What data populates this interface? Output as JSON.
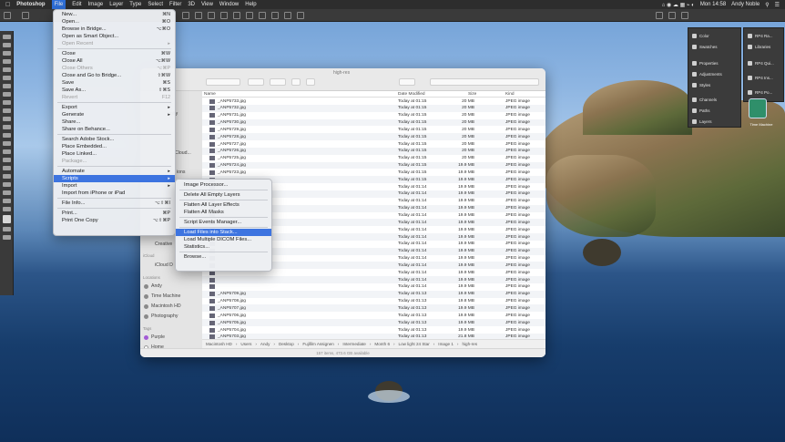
{
  "menubar": {
    "app": "Photoshop",
    "items": [
      "File",
      "Edit",
      "Image",
      "Layer",
      "Type",
      "Select",
      "Filter",
      "3D",
      "View",
      "Window",
      "Help"
    ],
    "clock": "Mon 14:58",
    "user": "Andy Noble"
  },
  "file_menu": [
    {
      "label": "New...",
      "sc": "⌘N"
    },
    {
      "label": "Open...",
      "sc": "⌘O"
    },
    {
      "label": "Browse in Bridge...",
      "sc": "⌥⌘O"
    },
    {
      "label": "Open as Smart Object..."
    },
    {
      "label": "Open Recent",
      "disabled": true,
      "sub": true
    },
    {
      "sep": true
    },
    {
      "label": "Close",
      "sc": "⌘W"
    },
    {
      "label": "Close All",
      "sc": "⌥⌘W"
    },
    {
      "label": "Close Others",
      "disabled": true,
      "sc": "⌥⌘P"
    },
    {
      "label": "Close and Go to Bridge...",
      "sc": "⇧⌘W"
    },
    {
      "label": "Save",
      "sc": "⌘S"
    },
    {
      "label": "Save As...",
      "sc": "⇧⌘S"
    },
    {
      "label": "Revert",
      "disabled": true,
      "sc": "F12"
    },
    {
      "sep": true
    },
    {
      "label": "Export",
      "sub": true
    },
    {
      "label": "Generate",
      "sub": true
    },
    {
      "label": "Share..."
    },
    {
      "label": "Share on Behance..."
    },
    {
      "sep": true
    },
    {
      "label": "Search Adobe Stock..."
    },
    {
      "label": "Place Embedded..."
    },
    {
      "label": "Place Linked..."
    },
    {
      "label": "Package...",
      "disabled": true
    },
    {
      "sep": true
    },
    {
      "label": "Automate",
      "sub": true
    },
    {
      "label": "Scripts",
      "sub": true,
      "highlight": true
    },
    {
      "label": "Import",
      "sub": true
    },
    {
      "label": "Import from iPhone or iPad"
    },
    {
      "sep": true
    },
    {
      "label": "File Info...",
      "sc": "⌥⇧⌘I"
    },
    {
      "sep": true
    },
    {
      "label": "Print...",
      "sc": "⌘P"
    },
    {
      "label": "Print One Copy",
      "sc": "⌥⇧⌘P"
    }
  ],
  "scripts_menu": [
    {
      "label": "Image Processor..."
    },
    {
      "sep": true
    },
    {
      "label": "Delete All Empty Layers"
    },
    {
      "sep": true
    },
    {
      "label": "Flatten All Layer Effects"
    },
    {
      "label": "Flatten All Masks"
    },
    {
      "sep": true
    },
    {
      "label": "Script Events Manager..."
    },
    {
      "sep": true
    },
    {
      "label": "Load Files into Stack...",
      "highlight": true
    },
    {
      "label": "Load Multiple DICOM Files..."
    },
    {
      "label": "Statistics..."
    },
    {
      "sep": true
    },
    {
      "label": "Browse..."
    }
  ],
  "finder": {
    "title": "high-res",
    "columns": {
      "name": "Name",
      "date": "Date Modified",
      "size": "Size",
      "kind": "Kind"
    },
    "files": [
      {
        "name": "_ANP5733.jpg",
        "date": "Today at 01:15",
        "size": "20 MB",
        "kind": "JPEG image"
      },
      {
        "name": "_ANP5732.jpg",
        "date": "Today at 01:15",
        "size": "20 MB",
        "kind": "JPEG image"
      },
      {
        "name": "_ANP5731.jpg",
        "date": "Today at 01:15",
        "size": "20 MB",
        "kind": "JPEG image"
      },
      {
        "name": "_ANP5730.jpg",
        "date": "Today at 01:15",
        "size": "20 MB",
        "kind": "JPEG image"
      },
      {
        "name": "_ANP5729.jpg",
        "date": "Today at 01:15",
        "size": "20 MB",
        "kind": "JPEG image"
      },
      {
        "name": "_ANP5728.jpg",
        "date": "Today at 01:15",
        "size": "20 MB",
        "kind": "JPEG image"
      },
      {
        "name": "_ANP5727.jpg",
        "date": "Today at 01:15",
        "size": "20 MB",
        "kind": "JPEG image"
      },
      {
        "name": "_ANP5726.jpg",
        "date": "Today at 01:15",
        "size": "20 MB",
        "kind": "JPEG image"
      },
      {
        "name": "_ANP5725.jpg",
        "date": "Today at 01:15",
        "size": "20 MB",
        "kind": "JPEG image"
      },
      {
        "name": "_ANP5724.jpg",
        "date": "Today at 01:15",
        "size": "19.9 MB",
        "kind": "JPEG image"
      },
      {
        "name": "_ANP5723.jpg",
        "date": "Today at 01:15",
        "size": "19.9 MB",
        "kind": "JPEG image"
      },
      {
        "name": "",
        "date": "Today at 01:15",
        "size": "19.9 MB",
        "kind": "JPEG image"
      },
      {
        "name": "",
        "date": "Today at 01:14",
        "size": "19.9 MB",
        "kind": "JPEG image"
      },
      {
        "name": "",
        "date": "Today at 01:14",
        "size": "19.9 MB",
        "kind": "JPEG image"
      },
      {
        "name": "",
        "date": "Today at 01:14",
        "size": "19.9 MB",
        "kind": "JPEG image"
      },
      {
        "name": "",
        "date": "Today at 01:14",
        "size": "19.9 MB",
        "kind": "JPEG image"
      },
      {
        "name": "",
        "date": "Today at 01:14",
        "size": "19.9 MB",
        "kind": "JPEG image"
      },
      {
        "name": "",
        "date": "Today at 01:14",
        "size": "19.9 MB",
        "kind": "JPEG image"
      },
      {
        "name": "",
        "date": "Today at 01:14",
        "size": "19.9 MB",
        "kind": "JPEG image"
      },
      {
        "name": "",
        "date": "Today at 01:14",
        "size": "19.9 MB",
        "kind": "JPEG image"
      },
      {
        "name": "",
        "date": "Today at 01:14",
        "size": "19.9 MB",
        "kind": "JPEG image"
      },
      {
        "name": "",
        "date": "Today at 01:14",
        "size": "19.9 MB",
        "kind": "JPEG image"
      },
      {
        "name": "",
        "date": "Today at 01:14",
        "size": "19.9 MB",
        "kind": "JPEG image"
      },
      {
        "name": "",
        "date": "Today at 01:14",
        "size": "19.9 MB",
        "kind": "JPEG image"
      },
      {
        "name": "",
        "date": "Today at 01:14",
        "size": "19.9 MB",
        "kind": "JPEG image"
      },
      {
        "name": "",
        "date": "Today at 01:14",
        "size": "19.9 MB",
        "kind": "JPEG image"
      },
      {
        "name": "",
        "date": "Today at 01:14",
        "size": "19.9 MB",
        "kind": "JPEG image"
      },
      {
        "name": "_ANP5709.jpg",
        "date": "Today at 01:13",
        "size": "19.9 MB",
        "kind": "JPEG image"
      },
      {
        "name": "_ANP5708.jpg",
        "date": "Today at 01:13",
        "size": "19.8 MB",
        "kind": "JPEG image"
      },
      {
        "name": "_ANP5707.jpg",
        "date": "Today at 01:13",
        "size": "19.9 MB",
        "kind": "JPEG image"
      },
      {
        "name": "_ANP5706.jpg",
        "date": "Today at 01:13",
        "size": "19.9 MB",
        "kind": "JPEG image"
      },
      {
        "name": "_ANP5705.jpg",
        "date": "Today at 01:13",
        "size": "19.9 MB",
        "kind": "JPEG image"
      },
      {
        "name": "_ANP5704.jpg",
        "date": "Today at 01:13",
        "size": "19.9 MB",
        "kind": "JPEG image"
      },
      {
        "name": "_ANP5703.jpg",
        "date": "Today at 01:13",
        "size": "21.8 MB",
        "kind": "JPEG image"
      },
      {
        "name": "_ANP5702.jpg",
        "date": "Today at 01:13",
        "size": "19.9 MB",
        "kind": "JPEG image"
      },
      {
        "name": "_ANP5701.jpg",
        "date": "Today at 01:13",
        "size": "19.9 MB",
        "kind": "JPEG image"
      }
    ],
    "sidebar": {
      "partial": [
        "aphy",
        "Cloud...",
        "ions",
        "Creative"
      ],
      "icloud_header": "iCloud",
      "icloud_item": "iCloud D",
      "locations_header": "Locations",
      "locations": [
        "Andy",
        "Time Machine",
        "Macintosh HD",
        "Photography"
      ],
      "tags_header": "Tags",
      "tags": [
        "Purple",
        "Home"
      ]
    },
    "path": [
      "Macintosh HD",
      "Users",
      "Andy",
      "Desktop",
      "Fujifilm Assignen",
      "Intermediate",
      "Month 6",
      "Low light 24 Star",
      "Image 1",
      "high-res"
    ],
    "status": "157 items, 473.6 GB available"
  },
  "panels": {
    "col1": [
      "Color",
      "Swatches",
      "Properties",
      "Adjustments",
      "Styles",
      "Channels",
      "Paths",
      "Layers"
    ],
    "col2": [
      "RP4 Ra...",
      "Libraries",
      "RP4 Qui...",
      "RP4 Ins...",
      "RP4 Po..."
    ]
  },
  "desktop_icon": "Time Machine",
  "colors": {
    "highlight": "#3d74e0",
    "menubar": "#2d2d2d",
    "purple_tag": "#a35bd6"
  }
}
